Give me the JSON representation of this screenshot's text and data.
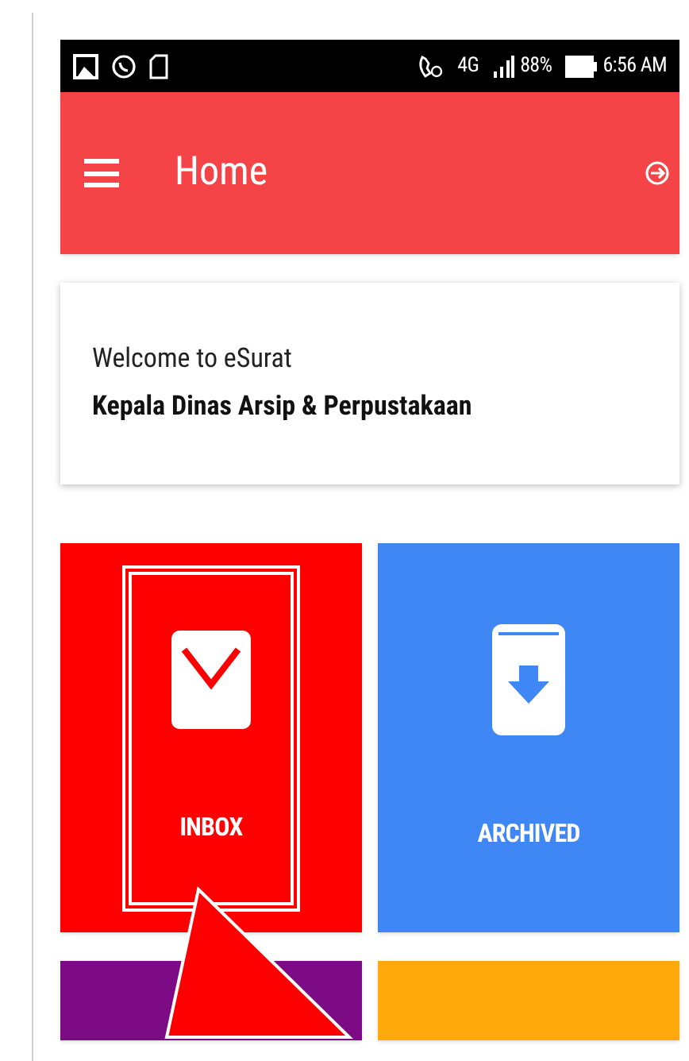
{
  "status_bar": {
    "network": "4G",
    "battery": "88%",
    "time": "6:56 AM"
  },
  "app_bar": {
    "title": "Home"
  },
  "welcome": {
    "greeting": "Welcome to eSurat",
    "name": "Kepala Dinas Arsip & Perpustakaan"
  },
  "tiles": [
    {
      "kind": "inbox",
      "label": "INBOX",
      "color": "#ff0000",
      "highlighted": true
    },
    {
      "kind": "archive",
      "label": "ARCHIVED",
      "color": "#3f87f5",
      "highlighted": false
    },
    {
      "kind": "blank",
      "color": "#7d0a85"
    },
    {
      "kind": "blank",
      "color": "#ffa90c"
    }
  ]
}
